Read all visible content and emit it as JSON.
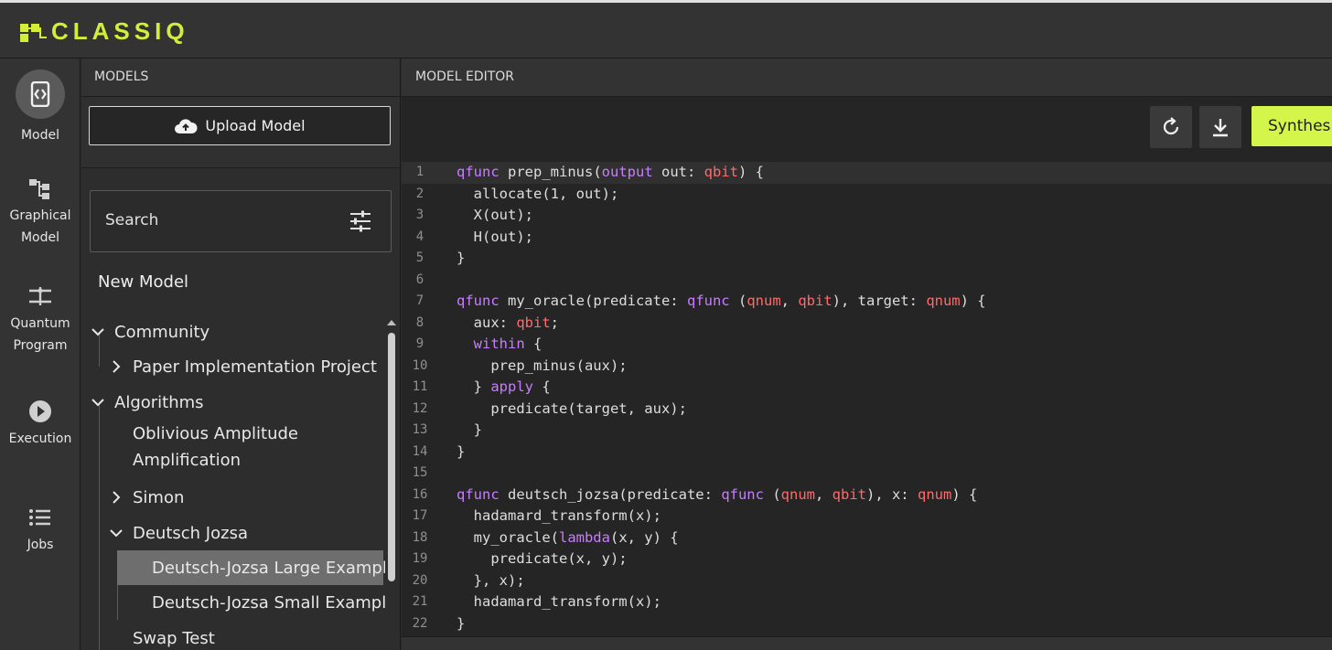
{
  "app": {
    "logo_text": "CLASSIQ",
    "accent": "#d4ed3a"
  },
  "nav": [
    {
      "id": "model",
      "label_lines": [
        "Model"
      ],
      "icon": "code-icon"
    },
    {
      "id": "graphical",
      "label_lines": [
        "Graphical",
        "Model"
      ],
      "icon": "hierarchy-icon"
    },
    {
      "id": "quantum",
      "label_lines": [
        "Quantum",
        "Program"
      ],
      "icon": "circuit-icon"
    },
    {
      "id": "execution",
      "label_lines": [
        "Execution"
      ],
      "icon": "play-icon"
    },
    {
      "id": "jobs",
      "label_lines": [
        "Jobs"
      ],
      "icon": "list-icon"
    }
  ],
  "models": {
    "header": "MODELS",
    "upload_label": "Upload Model",
    "search_placeholder": "Search",
    "new_model": "New Model",
    "tree": [
      {
        "label": "Community",
        "level": 0,
        "state": "expanded"
      },
      {
        "label": "Paper Implementation Project",
        "level": 1,
        "state": "collapsed"
      },
      {
        "label": "Algorithms",
        "level": 0,
        "state": "expanded"
      },
      {
        "label": "Oblivious Amplitude",
        "level": 1,
        "state": "leaf"
      },
      {
        "label": "Amplification",
        "level": 1,
        "state": "leaf-cont"
      },
      {
        "label": "Simon",
        "level": 1,
        "state": "collapsed"
      },
      {
        "label": "Deutsch Jozsa",
        "level": 1,
        "state": "expanded"
      },
      {
        "label": "Deutsch-Jozsa Large Example",
        "level": 2,
        "state": "selected"
      },
      {
        "label": "Deutsch-Jozsa Small Example",
        "level": 2,
        "state": "leaf"
      },
      {
        "label": "Swap Test",
        "level": 1,
        "state": "leaf"
      }
    ]
  },
  "editor": {
    "header": "MODEL EDITOR",
    "synthesize_label": "Synthesize",
    "code": [
      [
        [
          "k",
          "qfunc"
        ],
        [
          "n",
          " prep_minus("
        ],
        [
          "k",
          "output"
        ],
        [
          "n",
          " out: "
        ],
        [
          "t",
          "qbit"
        ],
        [
          "n",
          ") {"
        ]
      ],
      [
        [
          "n",
          "  allocate(1, out);"
        ]
      ],
      [
        [
          "n",
          "  X(out);"
        ]
      ],
      [
        [
          "n",
          "  H(out);"
        ]
      ],
      [
        [
          "n",
          "}"
        ]
      ],
      [],
      [
        [
          "k",
          "qfunc"
        ],
        [
          "n",
          " my_oracle(predicate: "
        ],
        [
          "k",
          "qfunc"
        ],
        [
          "n",
          " ("
        ],
        [
          "t",
          "qnum"
        ],
        [
          "n",
          ", "
        ],
        [
          "t",
          "qbit"
        ],
        [
          "n",
          "), target: "
        ],
        [
          "t",
          "qnum"
        ],
        [
          "n",
          ") {"
        ]
      ],
      [
        [
          "n",
          "  aux: "
        ],
        [
          "t",
          "qbit"
        ],
        [
          "n",
          ";"
        ]
      ],
      [
        [
          "n",
          "  "
        ],
        [
          "k",
          "within"
        ],
        [
          "n",
          " {"
        ]
      ],
      [
        [
          "n",
          "    prep_minus(aux);"
        ]
      ],
      [
        [
          "n",
          "  } "
        ],
        [
          "k",
          "apply"
        ],
        [
          "n",
          " {"
        ]
      ],
      [
        [
          "n",
          "    predicate(target, aux);"
        ]
      ],
      [
        [
          "n",
          "  }"
        ]
      ],
      [
        [
          "n",
          "}"
        ]
      ],
      [],
      [
        [
          "k",
          "qfunc"
        ],
        [
          "n",
          " deutsch_jozsa(predicate: "
        ],
        [
          "k",
          "qfunc"
        ],
        [
          "n",
          " ("
        ],
        [
          "t",
          "qnum"
        ],
        [
          "n",
          ", "
        ],
        [
          "t",
          "qbit"
        ],
        [
          "n",
          "), x: "
        ],
        [
          "t",
          "qnum"
        ],
        [
          "n",
          ") {"
        ]
      ],
      [
        [
          "n",
          "  hadamard_transform(x);"
        ]
      ],
      [
        [
          "n",
          "  my_oracle("
        ],
        [
          "k",
          "lambda"
        ],
        [
          "n",
          "(x, y) {"
        ]
      ],
      [
        [
          "n",
          "    predicate(x, y);"
        ]
      ],
      [
        [
          "n",
          "  }, x);"
        ]
      ],
      [
        [
          "n",
          "  hadamard_transform(x);"
        ]
      ],
      [
        [
          "n",
          "}"
        ]
      ]
    ]
  }
}
